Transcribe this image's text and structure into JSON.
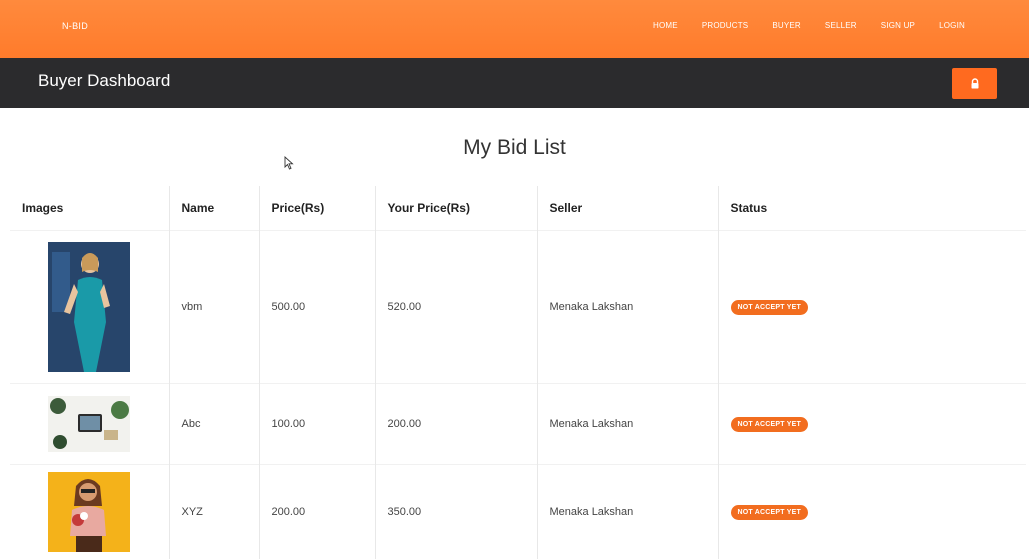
{
  "nav": {
    "brand": "N-BID",
    "items": [
      "HOME",
      "PRODUCTS",
      "BUYER",
      "SELLER",
      "SIGN UP",
      "LOGIN"
    ]
  },
  "dashboard": {
    "title": "Buyer Dashboard"
  },
  "main": {
    "heading": "My Bid List"
  },
  "table": {
    "headers": [
      "Images",
      "Name",
      "Price(Rs)",
      "Your Price(Rs)",
      "Seller",
      "Status"
    ],
    "rows": [
      {
        "name": "vbm",
        "price": "500.00",
        "your_price": "520.00",
        "seller": "Menaka Lakshan",
        "status": "NOT ACCEPT YET"
      },
      {
        "name": "Abc",
        "price": "100.00",
        "your_price": "200.00",
        "seller": "Menaka Lakshan",
        "status": "NOT ACCEPT YET"
      },
      {
        "name": "XYZ",
        "price": "200.00",
        "your_price": "350.00",
        "seller": "Menaka Lakshan",
        "status": "NOT ACCEPT YET"
      }
    ]
  },
  "colors": {
    "accent": "#ff7b2b",
    "header_dark": "#2b2b2d",
    "badge": "#f26d1f"
  },
  "icons": {
    "lock": "lock-icon",
    "cursor": "mouse-cursor-icon"
  }
}
